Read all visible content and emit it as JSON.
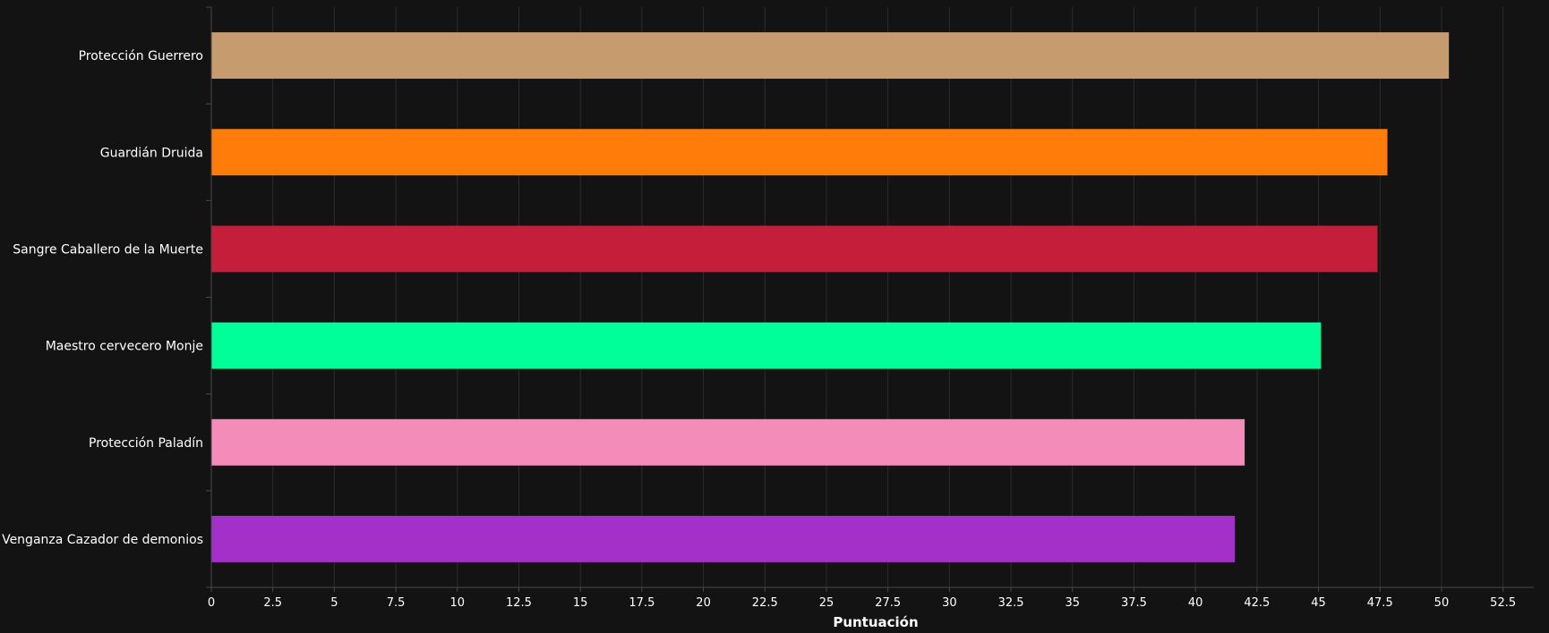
{
  "chart_data": {
    "type": "bar",
    "orientation": "horizontal",
    "title": "",
    "xlabel": "Puntuación",
    "ylabel": "",
    "xlim": [
      0,
      53.75
    ],
    "x_ticks": [
      0,
      2.5,
      5,
      7.5,
      10,
      12.5,
      15,
      17.5,
      20,
      22.5,
      25,
      27.5,
      30,
      32.5,
      35,
      37.5,
      40,
      42.5,
      45,
      47.5,
      50,
      52.5
    ],
    "grid": true,
    "legend": "none",
    "categories": [
      "Protección Guerrero",
      "Guardián Druida",
      "Sangre Caballero de la Muerte",
      "Maestro cervecero Monje",
      "Protección Paladín",
      "Venganza Cazador de demonios"
    ],
    "values": [
      50.3,
      47.8,
      47.4,
      45.1,
      42.0,
      41.6
    ],
    "colors": [
      "#C69B6D",
      "#FF7C0A",
      "#C41E3A",
      "#00FF98",
      "#F48CBA",
      "#A330C9"
    ]
  },
  "colors": {
    "background": "#131313",
    "grid": "#2c2c2c",
    "axis": "#4a4a4a",
    "text": "#ffffff"
  }
}
